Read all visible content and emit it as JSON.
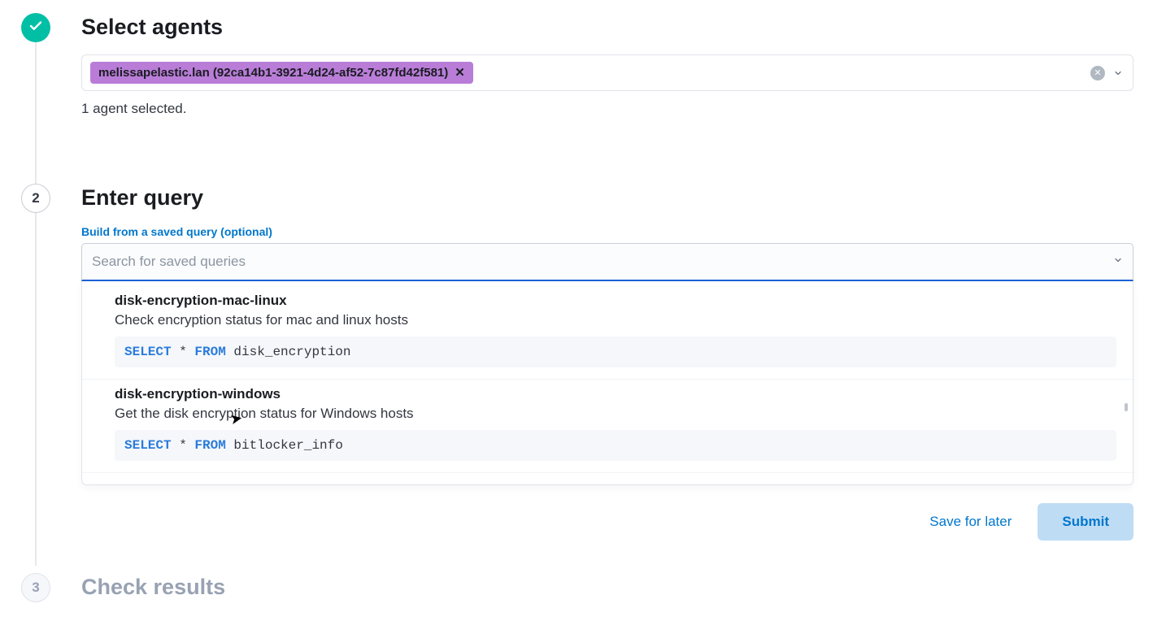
{
  "steps": {
    "s1": {
      "title": "Select agents",
      "status": "done"
    },
    "s2": {
      "title": "Enter query",
      "number": "2",
      "status": "current"
    },
    "s3": {
      "title": "Check results",
      "number": "3",
      "status": "future"
    }
  },
  "agents": {
    "pill_label": "melissapelastic.lan (92ca14b1-3921-4d24-af52-7c87fd42f581)",
    "selected_count_text": "1 agent selected."
  },
  "saved_query": {
    "label": "Build from a saved query (optional)",
    "placeholder": "Search for saved queries",
    "options": [
      {
        "title": "disk-encryption-mac-linux",
        "description": "Check encryption status for mac and linux hosts",
        "sql_kw1": "SELECT",
        "sql_star": " * ",
        "sql_kw2": "FROM",
        "sql_rest": " disk_encryption"
      },
      {
        "title": "disk-encryption-windows",
        "description": "Get the disk encryption status for Windows hosts",
        "sql_kw1": "SELECT",
        "sql_star": " * ",
        "sql_kw2": "FROM",
        "sql_rest": " bitlocker_info"
      }
    ]
  },
  "actions": {
    "save_label": "Save for later",
    "submit_label": "Submit"
  }
}
